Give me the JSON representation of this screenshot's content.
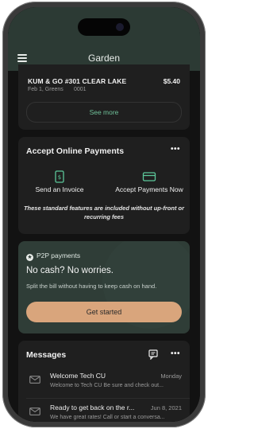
{
  "header": {
    "title": "Garden"
  },
  "transaction": {
    "merchant": "KUM & GO #301 CLEAR LAKE",
    "amount": "$5.40",
    "subtitle": "Feb 1, Greens",
    "number": "0001",
    "see_more_label": "See more"
  },
  "payments": {
    "title": "Accept Online Payments",
    "menu_label": "•••",
    "options": [
      {
        "label": "Send an Invoice",
        "icon": "invoice-icon"
      },
      {
        "label": "Accept Payments Now",
        "icon": "card-icon"
      }
    ],
    "note": "These standard features are included without up-front or recurring fees"
  },
  "p2p": {
    "label": "P2P payments",
    "headline": "No cash? No worries.",
    "body": "Split the bill without having to keep cash on hand.",
    "button_label": "Get started"
  },
  "messages": {
    "title": "Messages",
    "menu_label": "•••",
    "items": [
      {
        "title": "Welcome Tech CU",
        "date": "Monday",
        "preview": "Welcome to Tech CU Be sure and check out..."
      },
      {
        "title": "Ready to get back on the r...",
        "date": "Jun 8, 2021",
        "preview": "We have great rates! Call or start a conversa..."
      }
    ]
  },
  "colors": {
    "header_bg": "#2c3a34",
    "accent_green": "#6fbf98",
    "button_peach": "#d9a57c",
    "card_bg": "#1f1f1f"
  }
}
